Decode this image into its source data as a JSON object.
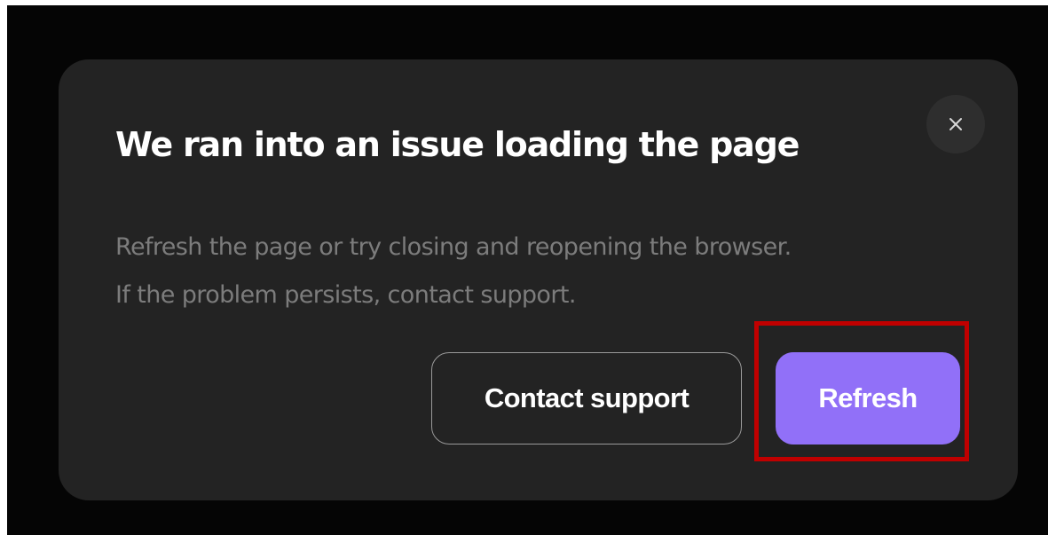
{
  "dialog": {
    "close_icon": "close-icon",
    "title": "We ran into an issue loading the page",
    "message_lines": [
      "Refresh the page or try closing and reopening the browser.",
      "If the problem persists, contact support."
    ],
    "buttons": {
      "contact_support": "Contact support",
      "refresh": "Refresh"
    }
  },
  "colors": {
    "background": "#050505",
    "dialog": "#232323",
    "primary_button": "#9170f8",
    "highlight_box": "#c00000"
  }
}
